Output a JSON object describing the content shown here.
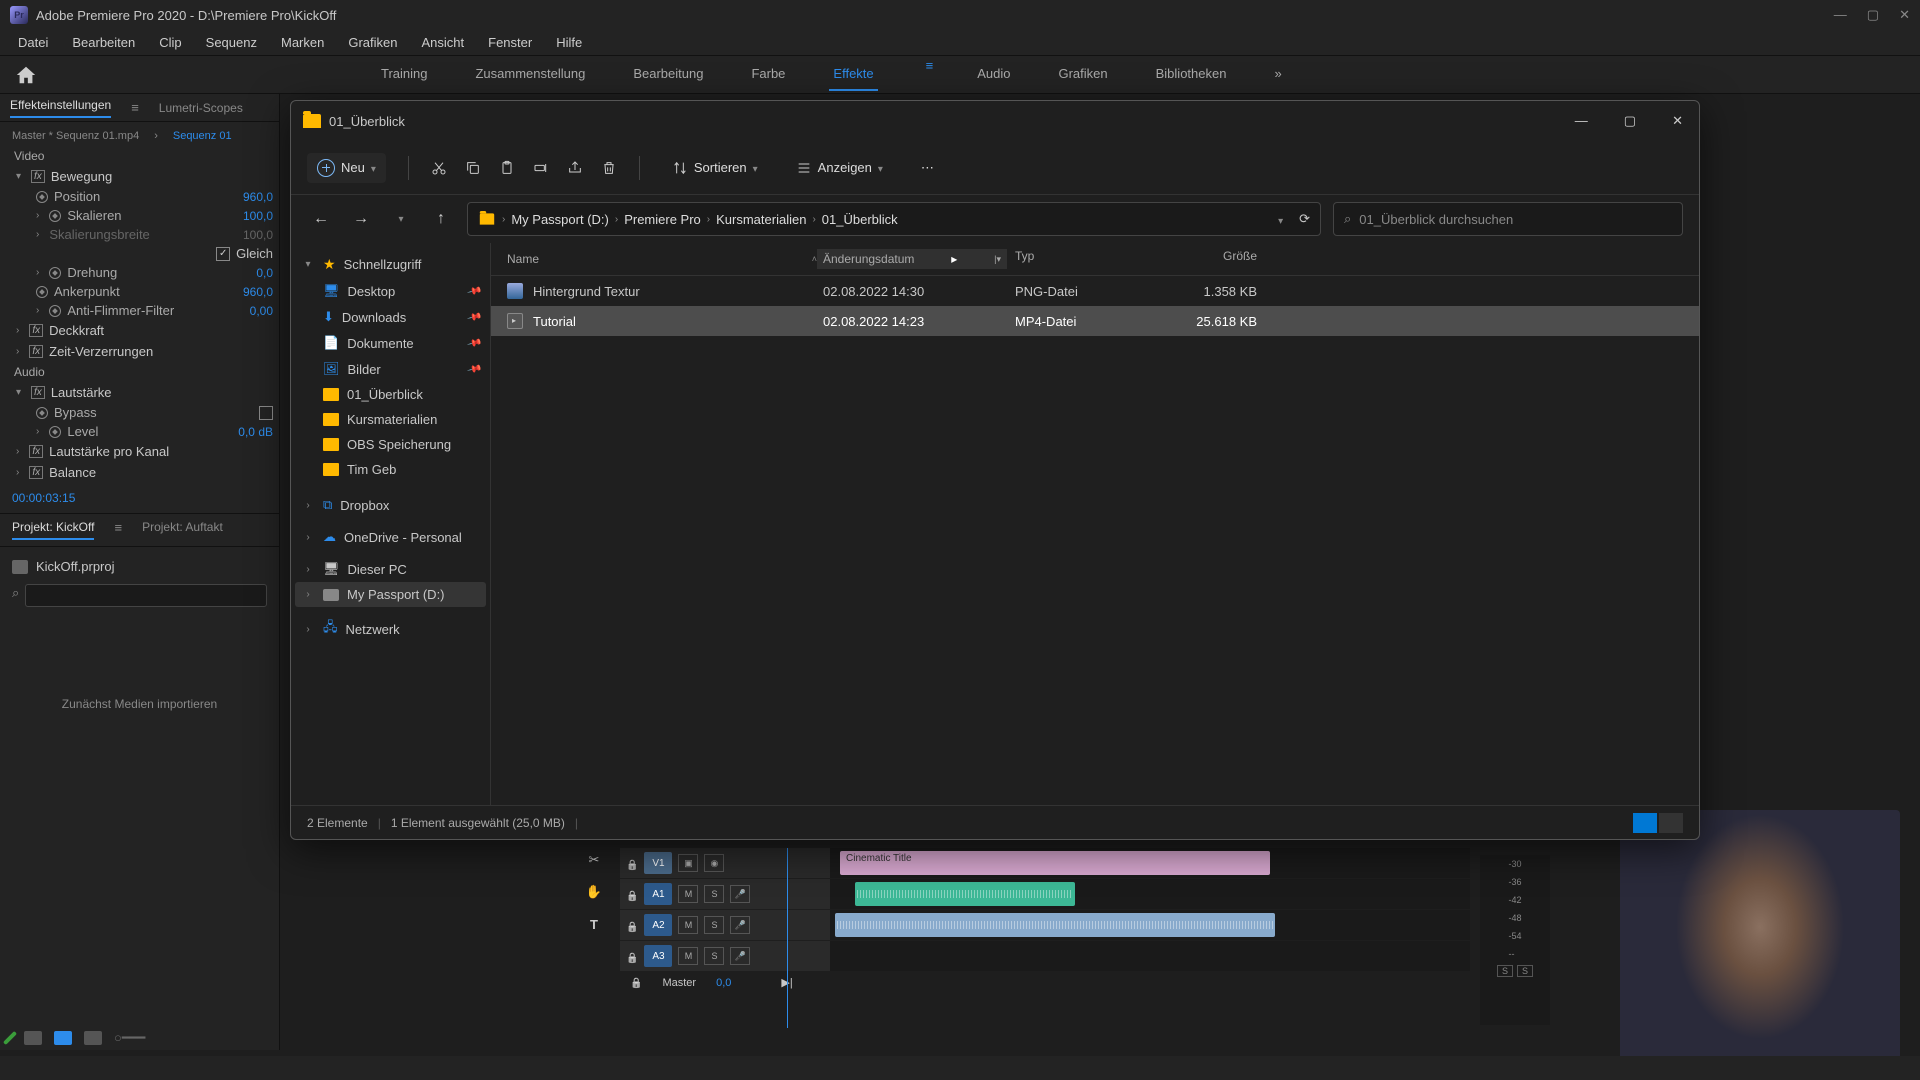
{
  "app": {
    "title": "Adobe Premiere Pro 2020 - D:\\Premiere Pro\\KickOff"
  },
  "menu": [
    "Datei",
    "Bearbeiten",
    "Clip",
    "Sequenz",
    "Marken",
    "Grafiken",
    "Ansicht",
    "Fenster",
    "Hilfe"
  ],
  "workspaces": {
    "items": [
      "Training",
      "Zusammenstellung",
      "Bearbeitung",
      "Farbe",
      "Effekte",
      "Audio",
      "Grafiken",
      "Bibliotheken"
    ],
    "active": "Effekte"
  },
  "left_panel": {
    "tabs": {
      "effect_controls": "Effekteinstellungen",
      "lumetri": "Lumetri-Scopes"
    },
    "master_label": "Master * Sequenz 01.mp4",
    "sequence_label": "Sequenz 01",
    "video_section": "Video",
    "audio_section": "Audio",
    "motion": {
      "label": "Bewegung",
      "position": {
        "label": "Position",
        "value": "960,0"
      },
      "scale": {
        "label": "Skalieren",
        "value": "100,0"
      },
      "scale_w": {
        "label": "Skalierungsbreite",
        "value": "100,0"
      },
      "uniform": "Gleich",
      "rotation": {
        "label": "Drehung",
        "value": "0,0"
      },
      "anchor": {
        "label": "Ankerpunkt",
        "value": "960,0"
      },
      "flicker": {
        "label": "Anti-Flimmer-Filter",
        "value": "0,00"
      }
    },
    "opacity": {
      "label": "Deckkraft"
    },
    "time": {
      "label": "Zeit-Verzerrungen"
    },
    "volume": {
      "label": "Lautstärke",
      "bypass": "Bypass",
      "level": {
        "label": "Level",
        "value": "0,0 dB"
      }
    },
    "channel_vol": "Lautstärke pro Kanal",
    "balance": "Balance",
    "timecode": "00:00:03:15"
  },
  "project": {
    "tab1": "Projekt: KickOff",
    "tab2": "Projekt: Auftakt",
    "file": "KickOff.prproj",
    "hint": "Zunächst Medien importieren"
  },
  "explorer": {
    "title": "01_Überblick",
    "toolbar": {
      "new": "Neu",
      "sort": "Sortieren",
      "view": "Anzeigen"
    },
    "breadcrumb": [
      "My Passport (D:)",
      "Premiere Pro",
      "Kursmaterialien",
      "01_Überblick"
    ],
    "search_placeholder": "01_Überblick durchsuchen",
    "sidebar": {
      "quickaccess": "Schnellzugriff",
      "desktop": "Desktop",
      "downloads": "Downloads",
      "documents": "Dokumente",
      "pictures": "Bilder",
      "overview": "01_Überblick",
      "materials": "Kursmaterialien",
      "obs": "OBS Speicherung",
      "tim": "Tim Geb",
      "dropbox": "Dropbox",
      "onedrive": "OneDrive - Personal",
      "thispc": "Dieser PC",
      "passport": "My Passport (D:)",
      "network": "Netzwerk"
    },
    "columns": {
      "name": "Name",
      "date": "Änderungsdatum",
      "type": "Typ",
      "size": "Größe"
    },
    "files": [
      {
        "name": "Hintergrund Textur",
        "date": "02.08.2022 14:30",
        "type": "PNG-Datei",
        "size": "1.358 KB"
      },
      {
        "name": "Tutorial",
        "date": "02.08.2022 14:23",
        "type": "MP4-Datei",
        "size": "25.618 KB"
      }
    ],
    "status": {
      "count": "2 Elemente",
      "selected": "1 Element ausgewählt (25,0 MB)"
    }
  },
  "timeline": {
    "tracks": {
      "v1": "V1",
      "a1": "A1",
      "a2": "A2",
      "a3": "A3"
    },
    "buttons": {
      "m": "M",
      "s": "S"
    },
    "clip_title": "Cinematic Title",
    "master": "Master",
    "master_val": "0,0"
  },
  "meters": {
    "labels": [
      "-30",
      "-36",
      "-42",
      "-48",
      "-54",
      "--"
    ],
    "solo": "S"
  }
}
